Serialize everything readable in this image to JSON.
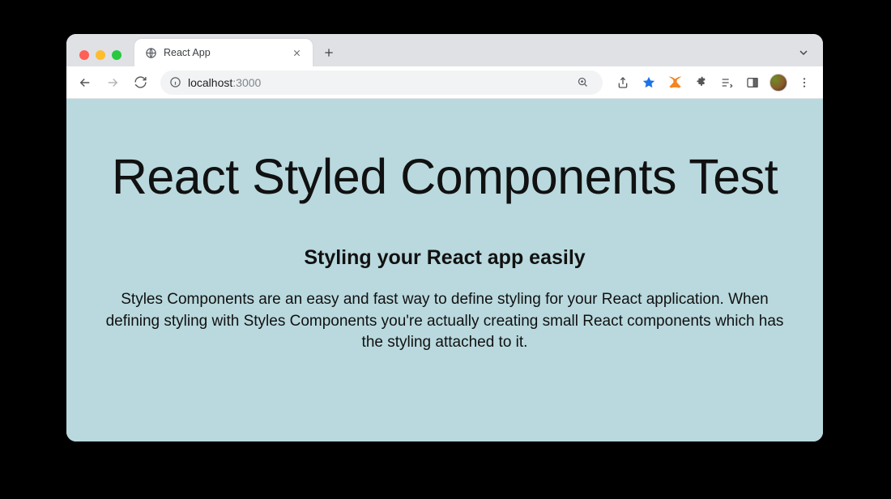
{
  "tab": {
    "title": "React App"
  },
  "address": {
    "host": "localhost",
    "port": ":3000"
  },
  "page": {
    "heading": "React Styled Components Test",
    "subheading": "Styling your React app easily",
    "body": "Styles Components are an easy and fast way to define styling for your React application. When defining styling with Styles Components you're actually creating small React components which has the styling attached to it."
  }
}
